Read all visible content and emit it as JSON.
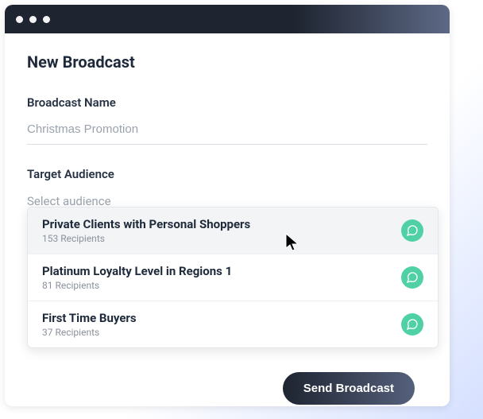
{
  "page_title": "New Broadcast",
  "name_field": {
    "label": "Broadcast Name",
    "value": "Christmas Promotion"
  },
  "audience_field": {
    "label": "Target Audience",
    "placeholder": "Select audience"
  },
  "audience_options": [
    {
      "title": "Private Clients with Personal Shoppers",
      "recipients": "153 Recipients",
      "highlighted": true
    },
    {
      "title": "Platinum Loyalty Level in Regions 1",
      "recipients": "81 Recipients",
      "highlighted": false
    },
    {
      "title": "First Time Buyers",
      "recipients": "37 Recipients",
      "highlighted": false
    }
  ],
  "send_button": "Send Broadcast"
}
